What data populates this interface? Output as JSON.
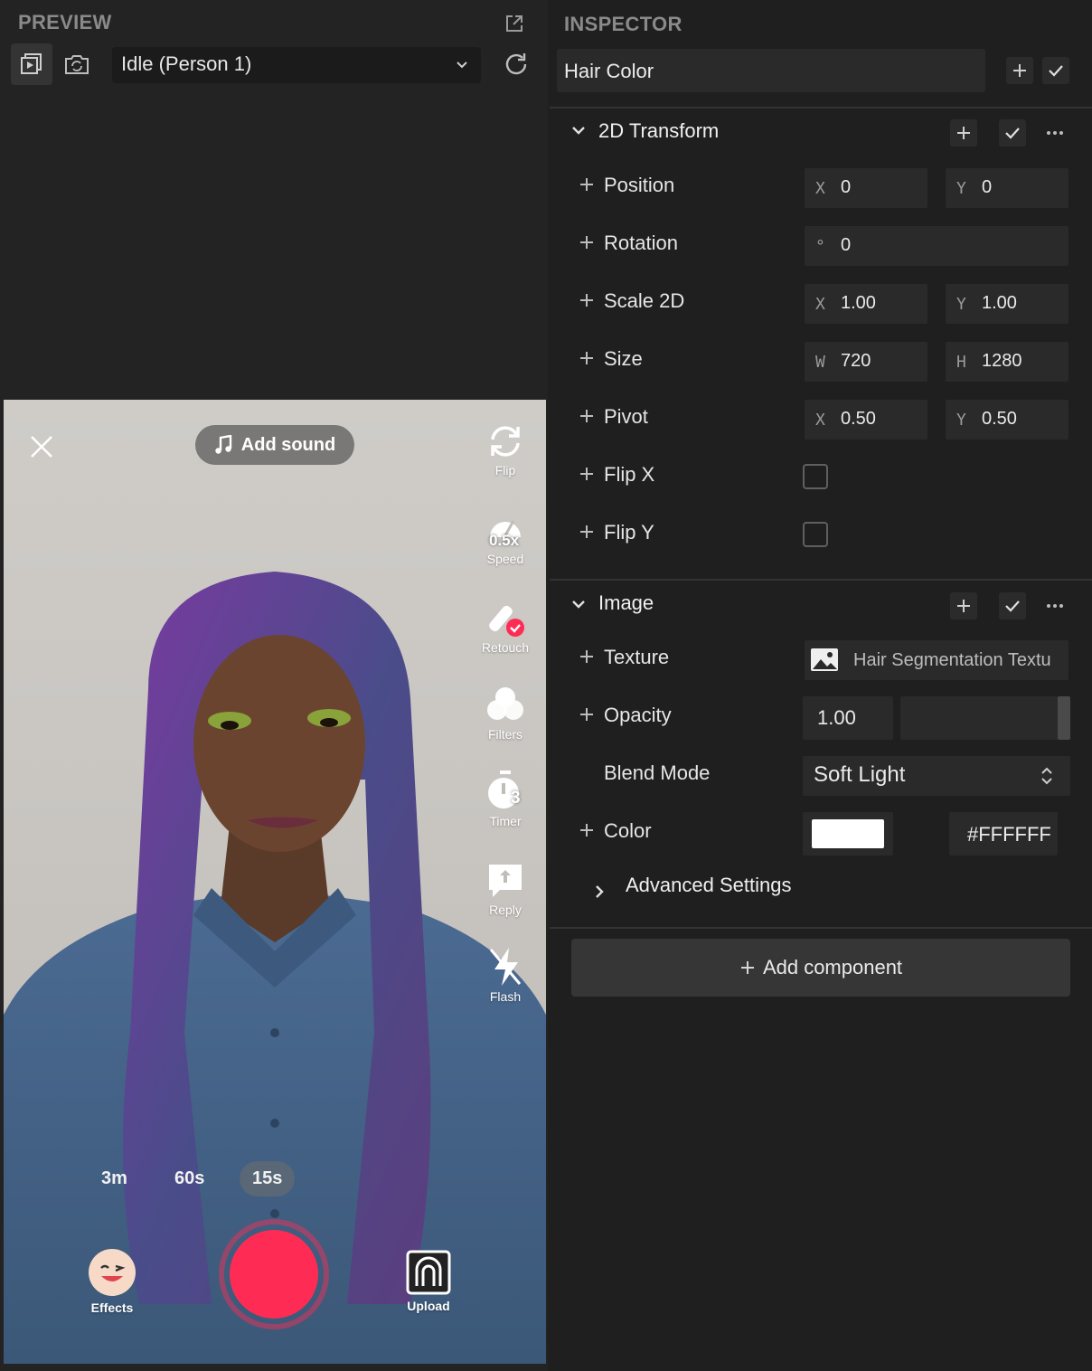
{
  "preview": {
    "title": "PREVIEW",
    "dropdown_value": "Idle (Person 1)",
    "phone": {
      "add_sound": "Add sound",
      "side_tools": [
        {
          "icon": "flip-icon",
          "label": "Flip"
        },
        {
          "icon": "speed-icon",
          "label": "Speed",
          "badge": "0.5x"
        },
        {
          "icon": "retouch-icon",
          "label": "Retouch"
        },
        {
          "icon": "filters-icon",
          "label": "Filters"
        },
        {
          "icon": "timer-icon",
          "label": "Timer",
          "badge": "3"
        },
        {
          "icon": "reply-icon",
          "label": "Reply"
        },
        {
          "icon": "flash-icon",
          "label": "Flash"
        }
      ],
      "durations": [
        "3m",
        "60s",
        "15s"
      ],
      "selected_duration": "15s",
      "effects_label": "Effects",
      "upload_label": "Upload",
      "record_color": "#fe2c55"
    }
  },
  "inspector": {
    "title": "INSPECTOR",
    "object_name": "Hair Color",
    "transform": {
      "title": "2D Transform",
      "position": {
        "label": "Position",
        "x_axis": "X",
        "x": "0",
        "y_axis": "Y",
        "y": "0"
      },
      "rotation": {
        "label": "Rotation",
        "axis": "°",
        "value": "0"
      },
      "scale": {
        "label": "Scale 2D",
        "x_axis": "X",
        "x": "1.00",
        "y_axis": "Y",
        "y": "1.00"
      },
      "size": {
        "label": "Size",
        "w_axis": "W",
        "w": "720",
        "h_axis": "H",
        "h": "1280"
      },
      "pivot": {
        "label": "Pivot",
        "x_axis": "X",
        "x": "0.50",
        "y_axis": "Y",
        "y": "0.50"
      },
      "flip_x": {
        "label": "Flip X",
        "checked": false
      },
      "flip_y": {
        "label": "Flip Y",
        "checked": false
      }
    },
    "image": {
      "title": "Image",
      "texture": {
        "label": "Texture",
        "value": "Hair Segmentation Textu"
      },
      "opacity": {
        "label": "Opacity",
        "value": "1.00",
        "level": 1.0
      },
      "blend": {
        "label": "Blend Mode",
        "value": "Soft Light"
      },
      "color": {
        "label": "Color",
        "hex": "#FFFFFF",
        "swatch": "#ffffff"
      },
      "advanced": "Advanced Settings"
    },
    "add_component": "Add component"
  }
}
